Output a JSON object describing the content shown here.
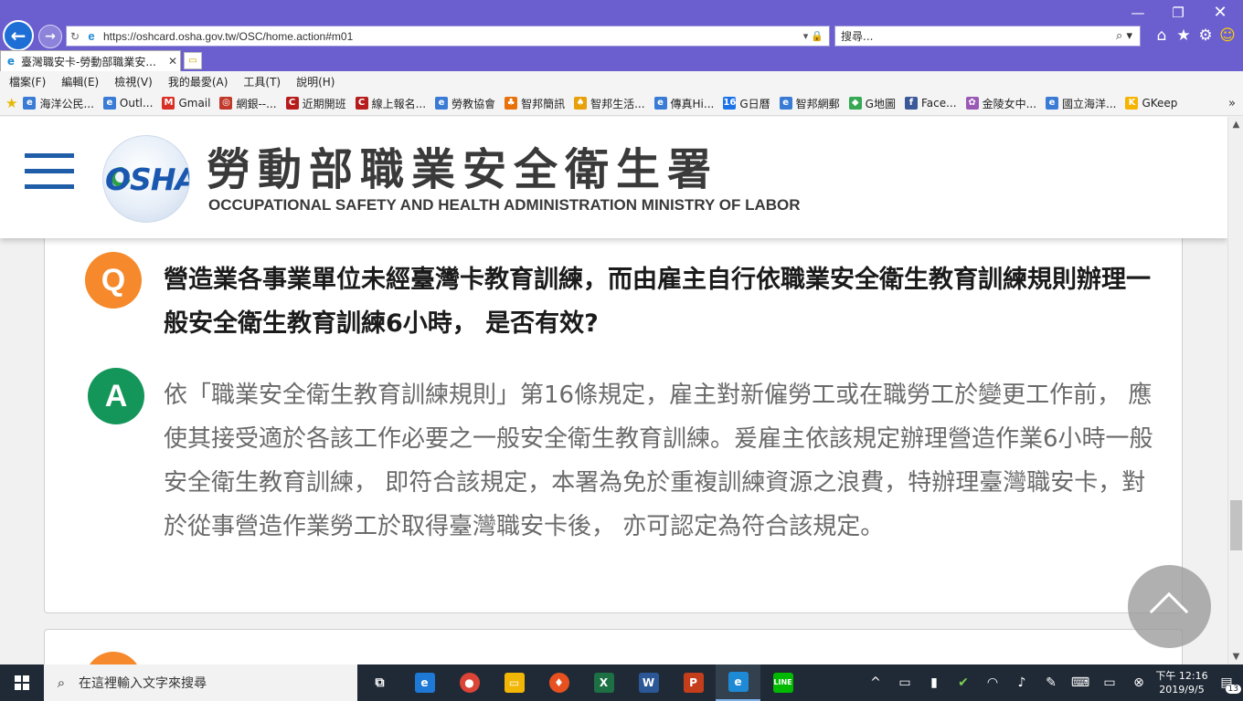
{
  "browser": {
    "url": "https://oshcard.osha.gov.tw/OSC/home.action#m01",
    "search_placeholder": "搜尋...",
    "tab_title": "臺灣職安卡-勞動部職業安...",
    "menu": [
      "檔案(F)",
      "編輯(E)",
      "檢視(V)",
      "我的最愛(A)",
      "工具(T)",
      "說明(H)"
    ],
    "favorites": [
      {
        "label": "海洋公民...",
        "color": "#3a7bd5",
        "glyph": "e"
      },
      {
        "label": "Outl...",
        "color": "#3a7bd5",
        "glyph": "e"
      },
      {
        "label": "Gmail",
        "color": "#d93025",
        "glyph": "M"
      },
      {
        "label": "網銀--...",
        "color": "#c0392b",
        "glyph": "◎"
      },
      {
        "label": "近期開班",
        "color": "#b71c1c",
        "glyph": "C"
      },
      {
        "label": "線上報名...",
        "color": "#b71c1c",
        "glyph": "C"
      },
      {
        "label": "勞教協會",
        "color": "#3a7bd5",
        "glyph": "e"
      },
      {
        "label": "智邦簡訊",
        "color": "#e8710a",
        "glyph": "♣"
      },
      {
        "label": "智邦生活...",
        "color": "#e8a00a",
        "glyph": "♠"
      },
      {
        "label": "傳真Hi...",
        "color": "#3a7bd5",
        "glyph": "e"
      },
      {
        "label": "G日曆",
        "color": "#1a73e8",
        "glyph": "16"
      },
      {
        "label": "智邦網郵",
        "color": "#3a7bd5",
        "glyph": "e"
      },
      {
        "label": "G地圖",
        "color": "#34a853",
        "glyph": "◆"
      },
      {
        "label": "Face...",
        "color": "#3b5998",
        "glyph": "f"
      },
      {
        "label": "金陵女中...",
        "color": "#9b59b6",
        "glyph": "✿"
      },
      {
        "label": "國立海洋...",
        "color": "#3a7bd5",
        "glyph": "e"
      },
      {
        "label": "GKeep",
        "color": "#f5b400",
        "glyph": "K"
      }
    ]
  },
  "header": {
    "logo_text": "OSHA",
    "title_zh": "勞動部職業安全衛生署",
    "title_en": "OCCUPATIONAL SAFETY AND HEALTH ADMINISTRATION MINISTRY OF LABOR"
  },
  "qa": {
    "q_label": "Q",
    "a_label": "A",
    "question": "營造業各事業單位未經臺灣卡教育訓練，而由雇主自行依職業安全衛生教育訓練規則辦理一般安全衛生教育訓練6小時， 是否有效?",
    "answer": "依「職業安全衛生教育訓練規則」第16條規定，雇主對新僱勞工或在職勞工於變更工作前， 應使其接受適於各該工作必要之一般安全衛生教育訓練。爰雇主依該規定辦理營造作業6小時一般安全衛生教育訓練， 即符合該規定，本署為免於重複訓練資源之浪費，特辦理臺灣職安卡，對於從事營造作業勞工於取得臺灣職安卡後， 亦可認定為符合該規定。"
  },
  "taskbar": {
    "search_placeholder": "在這裡輸入文字來搜尋",
    "clock_period": "下午 12:16",
    "clock_date": "2019/9/5",
    "notification_count": "13"
  }
}
